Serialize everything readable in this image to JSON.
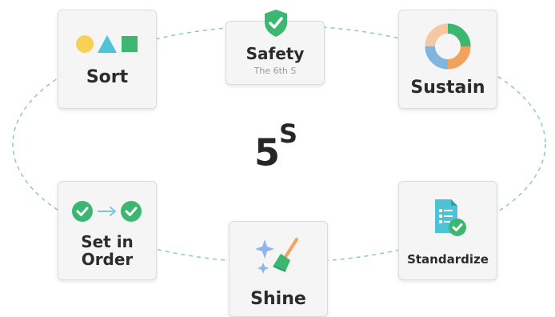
{
  "title": {
    "main": "5",
    "sup": "S"
  },
  "items": {
    "sort": {
      "label": "Sort"
    },
    "safety": {
      "label": "Safety",
      "sublabel": "The 6th S"
    },
    "sustain": {
      "label": "Sustain"
    },
    "set_in_order": {
      "label_line1": "Set in",
      "label_line2": "Order"
    },
    "shine": {
      "label": "Shine"
    },
    "standardize": {
      "label": "Standardize"
    }
  },
  "colors": {
    "green": "#3cb671",
    "teal": "#4fc3d6",
    "yellow": "#f7d155",
    "orange": "#f3a25c",
    "blue": "#7fb6e0",
    "dashed": "#8fc5cc"
  }
}
